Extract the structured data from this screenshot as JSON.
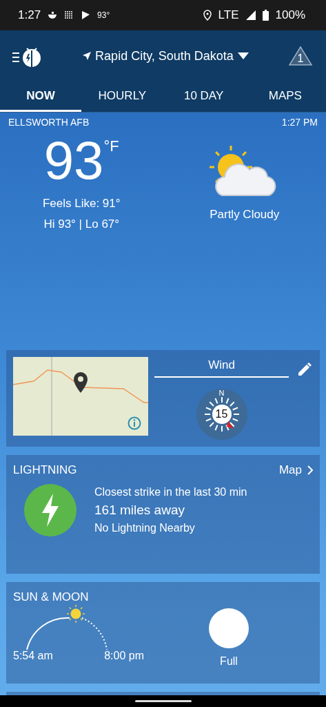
{
  "status_bar": {
    "time": "1:27",
    "temp": "93°",
    "network": "LTE",
    "battery": "100%"
  },
  "header": {
    "location": "Rapid City, South Dakota",
    "alert_count": "1"
  },
  "tabs": [
    {
      "label": "NOW",
      "selected": true
    },
    {
      "label": "HOURLY",
      "selected": false
    },
    {
      "label": "10 DAY",
      "selected": false
    },
    {
      "label": "MAPS",
      "selected": false
    }
  ],
  "current": {
    "station": "ELLSWORTH AFB",
    "time": "1:27 PM",
    "temperature": "93",
    "unit": "°F",
    "feels_like": "Feels Like: 91°",
    "hi_lo": "Hi 93° | Lo 67°",
    "condition": "Partly Cloudy"
  },
  "wind": {
    "title": "Wind",
    "north": "N",
    "speed": "15"
  },
  "lightning": {
    "title": "LIGHTNING",
    "link": "Map",
    "closest": "Closest strike in the last 30 min",
    "distance": "161 miles away",
    "status": "No Lightning Nearby"
  },
  "sun_moon": {
    "title": "SUN & MOON",
    "sunrise": "5:54 am",
    "sunset": "8:00 pm",
    "moon_phase": "Full"
  }
}
